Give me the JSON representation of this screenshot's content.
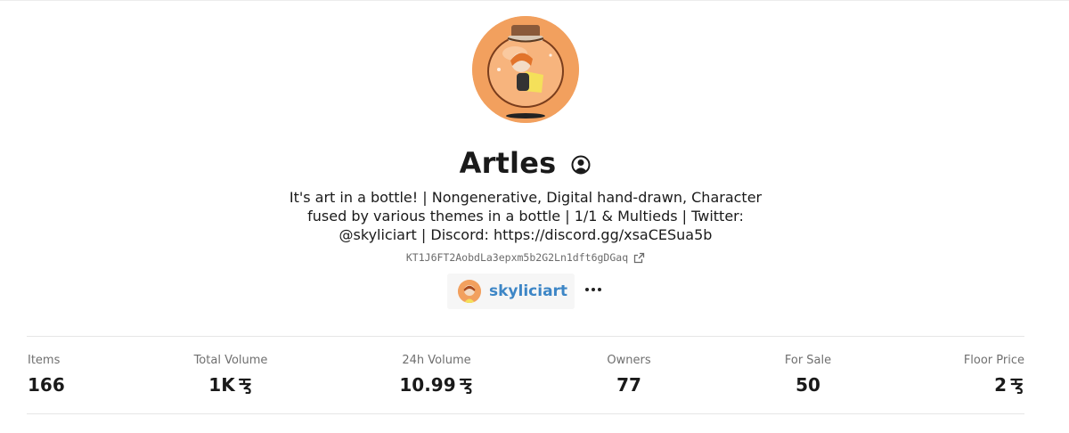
{
  "collection": {
    "title": "Artles",
    "description": "It's art in a bottle! | Nongenerative, Digital hand-drawn, Character fused by various themes in a bottle | 1/1 & Multieds | Twitter: @skyliciart | Discord: https://discord.gg/xsaCESua5b",
    "contract_address": "KT1J6FT2AobdLa3epxm5b2G2Ln1dft6gDGaq"
  },
  "creator": {
    "name": "skyliciart"
  },
  "stats": [
    {
      "label": "Items",
      "value": "166",
      "tez": false
    },
    {
      "label": "Total Volume",
      "value": "1K",
      "tez": true
    },
    {
      "label": "24h Volume",
      "value": "10.99",
      "tez": true
    },
    {
      "label": "Owners",
      "value": "77",
      "tez": false
    },
    {
      "label": "For Sale",
      "value": "50",
      "tez": false
    },
    {
      "label": "Floor Price",
      "value": "2",
      "tez": true
    }
  ],
  "colors": {
    "accent_link": "#3d86c6",
    "avatar_background": "#f2a05e"
  },
  "icons": {
    "profile": "user-circle-icon",
    "external_link": "external-link-icon",
    "more": "more-dots-icon",
    "currency": "tez-icon"
  }
}
